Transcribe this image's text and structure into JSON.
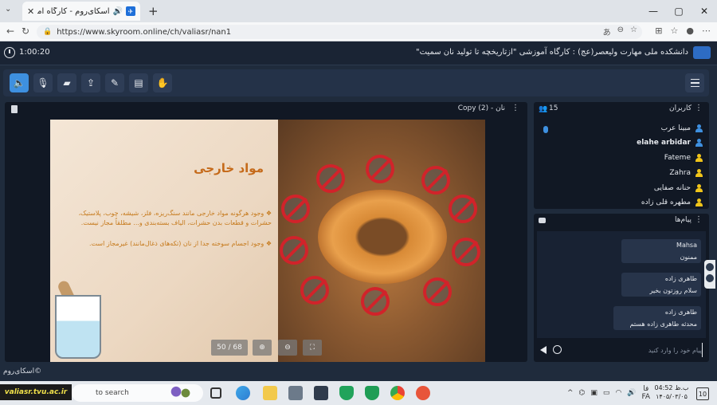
{
  "browser": {
    "tab_title": "اسکای‌روم - کارگاه آموزشی \"از",
    "url": "https://www.skyroom.online/ch/valiasr/nan1"
  },
  "header": {
    "timer": "1:00:20",
    "room_title": "دانشکده ملی مهارت ولیعصر(عج) : کارگاه آموزشی \"ازتاریخچه تا تولید نان سمیت\""
  },
  "presentation": {
    "title": "نان - (2) Copy",
    "page_indicator": "50 / 68",
    "slide": {
      "heading": "مواد خارجی",
      "bullet1": "❖ وجود هرگونه مواد خارجی مانند سنگ‌ریزه، فلز، شیشه، چوب، پلاستیک، حشرات و قطعات بدن حشرات، الیاف بسته‌بندی و... مطلقاً مجاز نیست.",
      "bullet2": "❖ وجود اجسام سوخته جدا از نان (تکه‌های ذغال‌مانند) غیرمجاز است."
    }
  },
  "brand": "©اسکای‌روم",
  "users": {
    "title": "کاربران",
    "count": "15",
    "list": [
      {
        "name": "مبینا عرب",
        "color": "#3e90e0",
        "bold": false
      },
      {
        "name": "elahe arbidar",
        "color": "#3e90e0",
        "bold": true
      },
      {
        "name": "Fateme",
        "color": "#f0c419",
        "bold": false
      },
      {
        "name": "Zahra",
        "color": "#f0c419",
        "bold": false
      },
      {
        "name": "حنانه صفایی",
        "color": "#f0c419",
        "bold": false
      },
      {
        "name": "مطهره قلی زاده",
        "color": "#f0c419",
        "bold": false
      }
    ]
  },
  "messages": {
    "title": "پیام‌ها",
    "list": [
      {
        "sender": "Mahsa",
        "text": "ممنون"
      },
      {
        "sender": "طاهری زاده",
        "text": "سلام روزتون بخیر"
      },
      {
        "sender": "طاهری زاده",
        "text": "محدثه طاهری زاده هستم"
      }
    ],
    "input_placeholder": "پیام خود را وارد کنید"
  },
  "taskbar": {
    "watermark": "valiasr.tvu.ac.ir",
    "search_text": "to search",
    "lang1": "فا",
    "lang2": "FA",
    "time": "04:52 ب.ظ",
    "date": "۱۴۰۵/۰۳/۰۵",
    "notifications": "10"
  },
  "colors": {
    "accent": "#3e90e0",
    "no_sign": "#d1232a",
    "heading": "#c56a1a"
  }
}
